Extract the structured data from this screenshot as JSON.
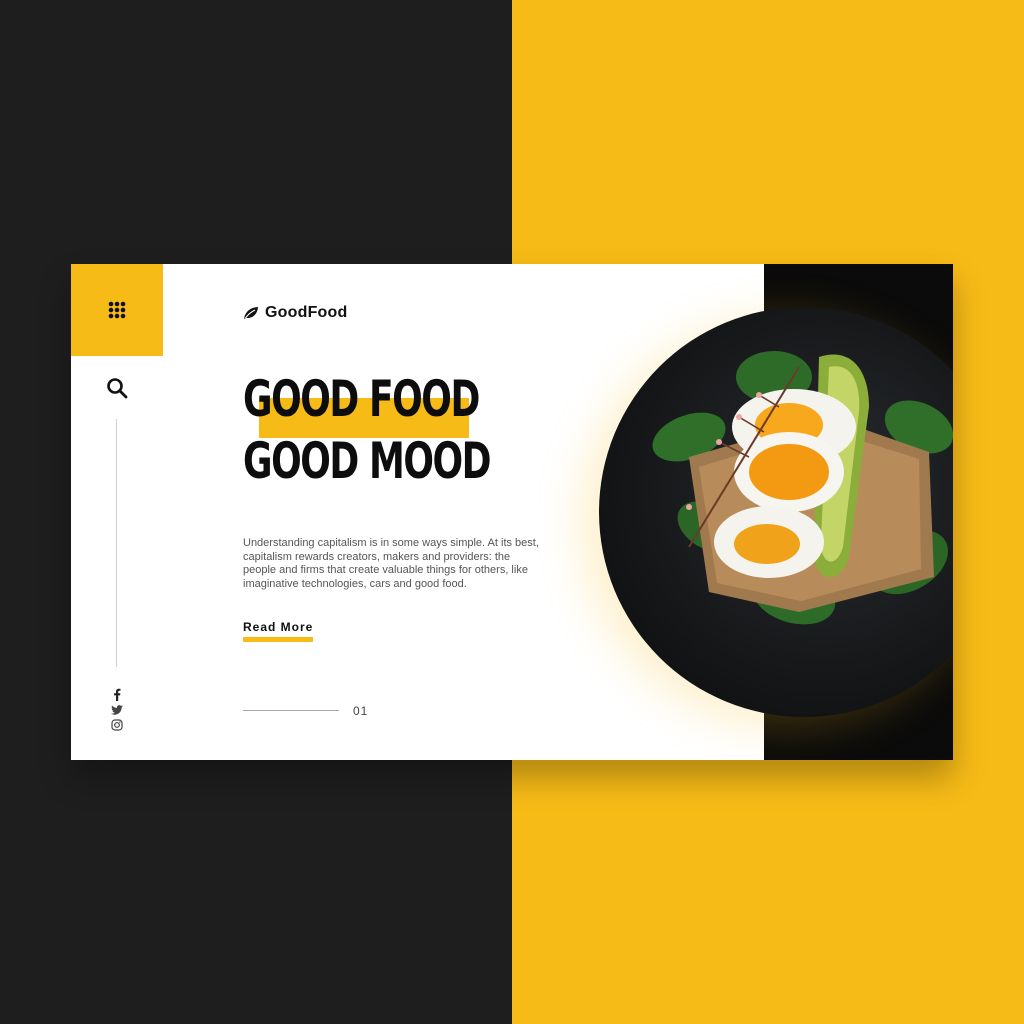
{
  "brand": {
    "name": "GoodFood",
    "logo_icon": "leaf-icon"
  },
  "hero": {
    "headline_line1": "GOOD FOOD",
    "headline_line2": "GOOD MOOD",
    "body": "Understanding capitalism is in some ways simple. At its best, capitalism rewards creators, makers and providers: the people and firms that create valuable things for others, like imaginative technologies, cars and good food.",
    "cta_label": "Read More"
  },
  "nav": {
    "menu_icon": "grid-menu-icon",
    "search_icon": "search-icon",
    "social": [
      "facebook-icon",
      "twitter-icon",
      "instagram-icon"
    ]
  },
  "pagination": {
    "current": "01"
  },
  "colors": {
    "accent": "#f7bb17",
    "dark": "#1e1e1e",
    "panel": "#0b0b0b",
    "text": "#0d0d0d"
  }
}
